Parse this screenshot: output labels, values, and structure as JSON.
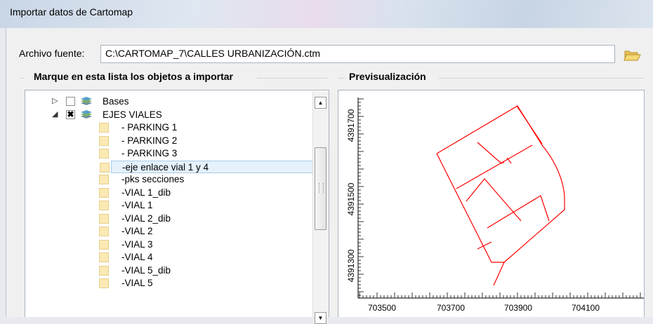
{
  "window": {
    "title": "Importar datos de Cartomap"
  },
  "source": {
    "label": "Archivo fuente:",
    "value": "C:\\CARTOMAP_7\\CALLES URBANIZACIÓN.ctm"
  },
  "objects_group": {
    "title": "Marque en esta lista los objetos a importar"
  },
  "preview_group": {
    "title": "Previsualización"
  },
  "tree": {
    "items": [
      {
        "label": "Bases",
        "checked": false,
        "expander": "collapsed",
        "level": 0,
        "icon": "layers-icon"
      },
      {
        "label": "EJES VIALES",
        "checked": true,
        "expander": "expanded",
        "level": 0,
        "icon": "layers-icon"
      },
      {
        "label": "- PARKING 1",
        "checked": true,
        "level": 1,
        "icon": "folder-icon"
      },
      {
        "label": "- PARKING 2",
        "checked": true,
        "level": 1,
        "icon": "folder-icon"
      },
      {
        "label": "- PARKING 3",
        "checked": true,
        "level": 1,
        "icon": "folder-icon"
      },
      {
        "label": "-eje enlace vial 1 y 4",
        "checked": true,
        "level": 1,
        "icon": "folder-icon",
        "selected": true
      },
      {
        "label": "-pks secciones",
        "checked": true,
        "level": 1,
        "icon": "folder-icon"
      },
      {
        "label": "-VIAL 1_dib",
        "checked": true,
        "level": 1,
        "icon": "folder-icon"
      },
      {
        "label": "-VIAL 1",
        "checked": true,
        "level": 1,
        "icon": "folder-icon"
      },
      {
        "label": "-VIAL 2_dib",
        "checked": true,
        "level": 1,
        "icon": "folder-icon"
      },
      {
        "label": "-VIAL 2",
        "checked": true,
        "level": 1,
        "icon": "folder-icon"
      },
      {
        "label": "-VIAL 3",
        "checked": true,
        "level": 1,
        "icon": "folder-icon"
      },
      {
        "label": "-VIAL 4",
        "checked": true,
        "level": 1,
        "icon": "folder-icon"
      },
      {
        "label": "-VIAL 5_dib",
        "checked": true,
        "level": 1,
        "icon": "folder-icon"
      },
      {
        "label": "-VIAL 5",
        "checked": true,
        "level": 1,
        "icon": "folder-icon"
      }
    ]
  },
  "preview": {
    "y_ticks": [
      "4391700",
      "4391500",
      "4391300"
    ],
    "x_ticks": [
      "703500",
      "703700",
      "703900",
      "704100"
    ],
    "line_color": "#ff0000"
  },
  "colors": {
    "selection": "#e5f1fb",
    "folder": "#fbe9b4"
  }
}
